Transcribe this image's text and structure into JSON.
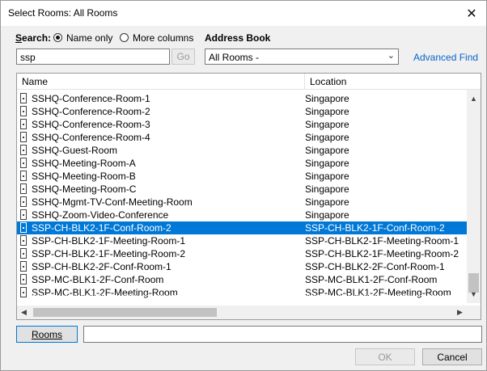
{
  "window": {
    "title": "Select Rooms: All Rooms"
  },
  "icons": {
    "close": "close-icon",
    "room": "room-icon",
    "dropdown": "chevron-down-icon"
  },
  "search": {
    "label": "Search:",
    "name_only_label": "Name only",
    "more_columns_label": "More columns",
    "selected": "name_only",
    "value": "ssp",
    "go_label": "Go"
  },
  "address_book": {
    "label": "Address Book",
    "selected": "All Rooms -",
    "advanced_find_label": "Advanced Find"
  },
  "list": {
    "columns": [
      "Name",
      "Location"
    ],
    "rows": [
      {
        "name": "SSHQ-Conference-Room-1",
        "location": "Singapore"
      },
      {
        "name": "SSHQ-Conference-Room-2",
        "location": "Singapore"
      },
      {
        "name": "SSHQ-Conference-Room-3",
        "location": "Singapore"
      },
      {
        "name": "SSHQ-Conference-Room-4",
        "location": "Singapore"
      },
      {
        "name": "SSHQ-Guest-Room",
        "location": "Singapore"
      },
      {
        "name": "SSHQ-Meeting-Room-A",
        "location": "Singapore"
      },
      {
        "name": "SSHQ-Meeting-Room-B",
        "location": "Singapore"
      },
      {
        "name": "SSHQ-Meeting-Room-C",
        "location": "Singapore"
      },
      {
        "name": "SSHQ-Mgmt-TV-Conf-Meeting-Room",
        "location": "Singapore"
      },
      {
        "name": "SSHQ-Zoom-Video-Conference",
        "location": "Singapore"
      },
      {
        "name": "SSP-CH-BLK2-1F-Conf-Room-2",
        "location": "SSP-CH-BLK2-1F-Conf-Room-2",
        "selected": true
      },
      {
        "name": "SSP-CH-BLK2-1F-Meeting-Room-1",
        "location": "SSP-CH-BLK2-1F-Meeting-Room-1"
      },
      {
        "name": "SSP-CH-BLK2-1F-Meeting-Room-2",
        "location": "SSP-CH-BLK2-1F-Meeting-Room-2"
      },
      {
        "name": "SSP-CH-BLK2-2F-Conf-Room-1",
        "location": "SSP-CH-BLK2-2F-Conf-Room-1"
      },
      {
        "name": "SSP-MC-BLK1-2F-Conf-Room",
        "location": "SSP-MC-BLK1-2F-Conf-Room"
      },
      {
        "name": "SSP-MC-BLK1-2F-Meeting-Room",
        "location": "SSP-MC-BLK1-2F-Meeting-Room"
      }
    ]
  },
  "footer": {
    "rooms_label": "Rooms",
    "rooms_value": "",
    "ok_label": "OK",
    "cancel_label": "Cancel"
  },
  "colors": {
    "selection": "#0078d7",
    "link": "#0a64c8",
    "dialog_bg": "#f0f0f0"
  }
}
